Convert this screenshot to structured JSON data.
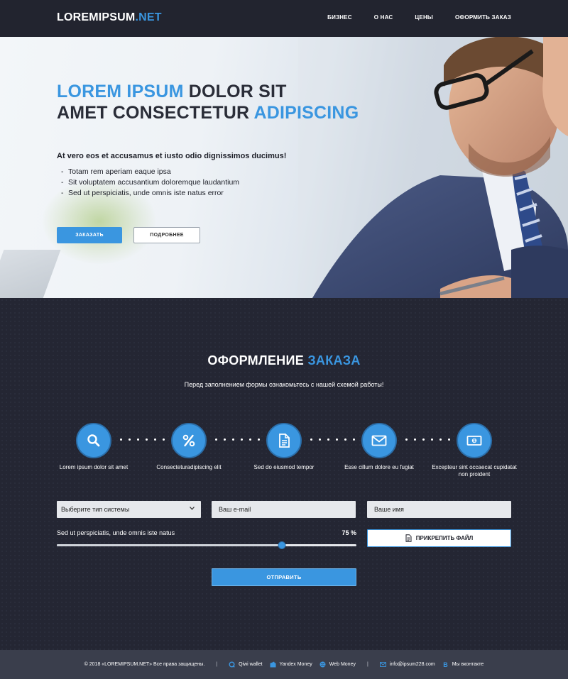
{
  "header": {
    "logo_main": "LOREMIPSUM",
    "logo_accent": ".NET",
    "nav": [
      "БИЗНЕС",
      "О НАС",
      "ЦЕНЫ",
      "ОФОРМИТЬ ЗАКАЗ"
    ]
  },
  "hero": {
    "title_line1_blue": "LOREM IPSUM",
    "title_line1_dark": " DOLOR SIT",
    "title_line2_dark": "AMET CONSECTETUR ",
    "title_line2_blue": "ADIPISCING",
    "lead": "At vero eos et accusamus et iusto odio dignissimos ducimus!",
    "list": [
      "Totam rem aperiam eaque ipsa",
      "Sit voluptatem accusantium doloremque laudantium",
      "Sed ut perspiciatis, unde omnis iste natus error"
    ],
    "btn_order": "ЗАКАЗАТЬ",
    "btn_more": "ПОДРОБНЕЕ"
  },
  "order": {
    "title_white": "ОФОРМЛЕНИЕ ",
    "title_blue": "ЗАКАЗА",
    "subtitle": "Перед заполнением формы ознакомьтесь с нашей схемой работы!",
    "steps": [
      {
        "label": "Lorem ipsum dolor sit amet",
        "icon": "search-icon"
      },
      {
        "label": "Consecteturadipiscing elit",
        "icon": "percent-icon"
      },
      {
        "label": "Sed do eiusmod tempor",
        "icon": "document-icon"
      },
      {
        "label": "Esse cillum dolore eu fugiat",
        "icon": "envelope-icon"
      },
      {
        "label": "Excepteur sint occaecat cupidatat non proident",
        "icon": "banknote-icon"
      }
    ],
    "select_value": "Выберите тип системы",
    "email_placeholder": "Ваш e-mail",
    "name_placeholder": "Ваше имя",
    "slider_label": "Sed ut perspiciatis, unde omnis iste natus",
    "slider_value_text": "75 %",
    "slider_value": 0.75,
    "attach_label": "ПРИКРЕПИТЬ ФАЙЛ",
    "submit_label": "ОТПРАВИТЬ"
  },
  "footer": {
    "copyright": "© 2018 «LOREMIPSUM.NET» Все права защищены.",
    "qiwi": "Qiwi wallet",
    "yandex": "Yandex Money",
    "webmoney": "Web Money",
    "email": "info@ipsum228.com",
    "vk": "Мы вконтакте"
  },
  "colors": {
    "accent": "#3a96e0",
    "dark_bg": "#22242f",
    "footer_bg": "#3a3e4c"
  }
}
